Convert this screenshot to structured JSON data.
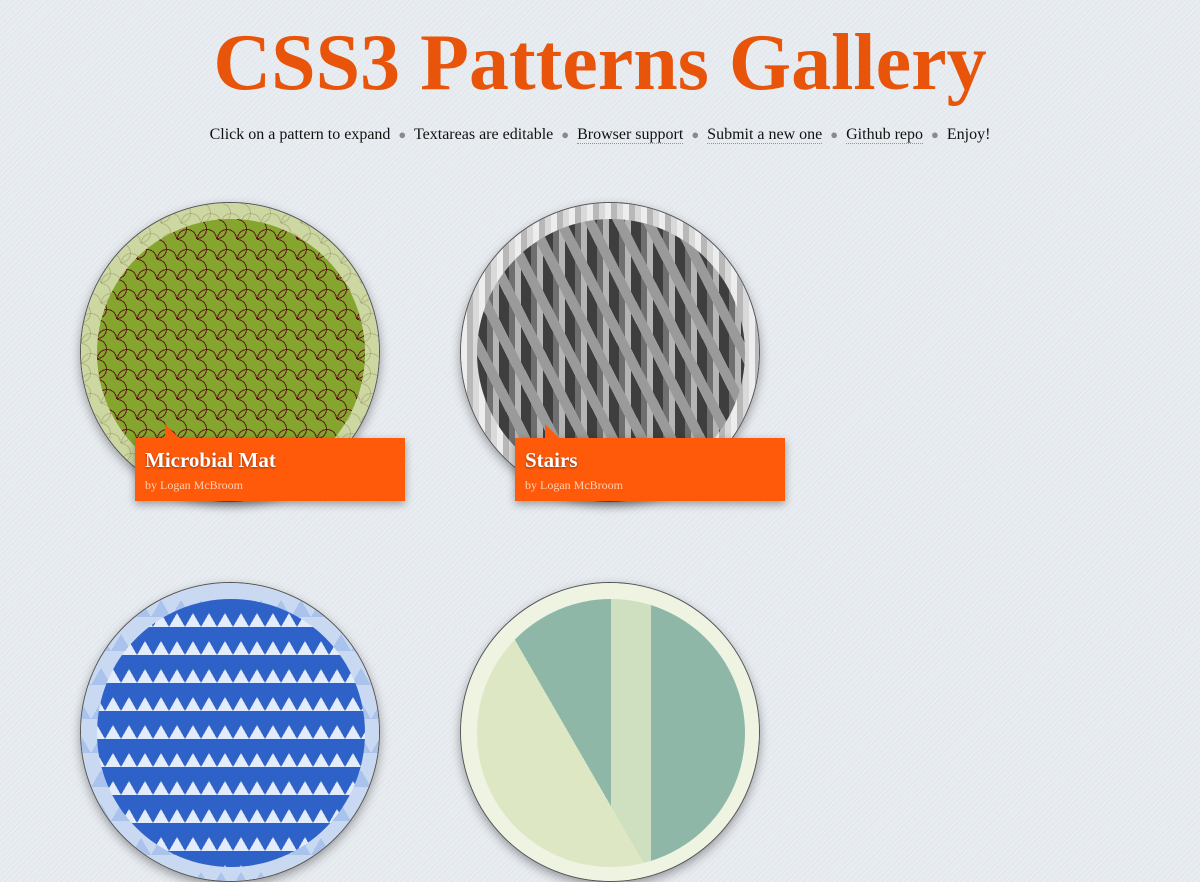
{
  "page": {
    "title": "CSS3 Patterns Gallery"
  },
  "subnav": {
    "intro": "Click on a pattern to expand",
    "editable": "Textareas are editable",
    "browser_support": "Browser support",
    "submit": "Submit a new one",
    "github": "Github repo",
    "enjoy": "Enjoy!",
    "separator": "●"
  },
  "patterns": [
    {
      "title": "Microbial Mat",
      "author": "by Logan McBroom"
    },
    {
      "title": "Stairs",
      "author": "by Logan McBroom"
    }
  ],
  "colors": {
    "accent": "#e8540a",
    "label_bg": "#ff5a0a",
    "background": "#e6ebf0"
  }
}
